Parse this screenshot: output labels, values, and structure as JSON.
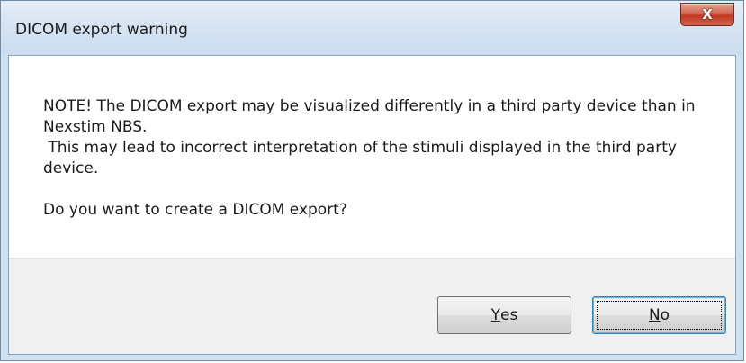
{
  "window": {
    "title": "DICOM export warning",
    "close_glyph": "X"
  },
  "message": {
    "line1": "NOTE! The DICOM export may be visualized differently in a third party device than in Nexstim NBS.",
    "line2": " This may lead to incorrect interpretation of the stimuli displayed in the third party device.",
    "question": "Do you want to create a DICOM export?"
  },
  "buttons": {
    "yes": {
      "mnemonic": "Y",
      "rest": "es"
    },
    "no": {
      "mnemonic": "N",
      "rest": "o"
    }
  },
  "icons": {
    "close": "close-icon"
  },
  "colors": {
    "close_button": "#c9452f",
    "focus_border": "#3c7fb1"
  }
}
